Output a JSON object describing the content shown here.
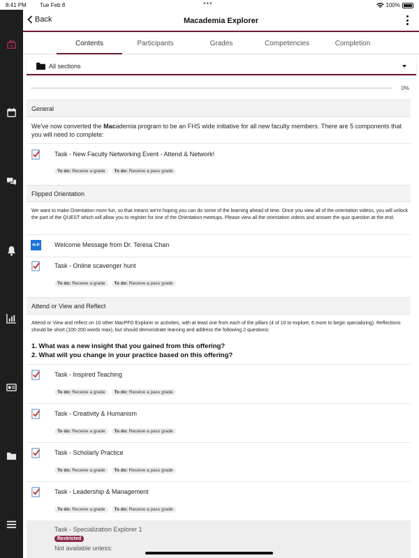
{
  "status": {
    "time": "8:41 PM",
    "date": "Tue Feb 8",
    "battery": "100%"
  },
  "header": {
    "back_label": "Back",
    "title": "Macademia Explorer"
  },
  "tabs": [
    {
      "label": "Contents",
      "active": true
    },
    {
      "label": "Participants",
      "active": false
    },
    {
      "label": "Grades",
      "active": false
    },
    {
      "label": "Competencies",
      "active": false
    },
    {
      "label": "Completion",
      "active": false
    }
  ],
  "section_select": {
    "value": "All sections"
  },
  "progress": {
    "percent": 0,
    "label": "0%"
  },
  "sections": {
    "general": {
      "title": "General",
      "description_pre": "We've now converted the ",
      "description_bold": "Mac",
      "description_post": "ademia program to be an FHS wide initiative for all new faculty members. There are 5 components that you will need to complete:",
      "items": [
        {
          "name": "Task - New Faculty Networking Event - Attend & Network!",
          "todo1": "Receive a grade",
          "todo2": "Receive a pass grade"
        }
      ]
    },
    "flipped": {
      "title": "Flipped Orientation",
      "description": "We want to make Orientation more fun, so that means we're hoping you can do some of the learning ahead of time. Once you view all of the orientation videos, you will unlock the part of the QUEST which will allow you to register for one of the Orientation meetups. Please view all the orientation videos and answer the quiz question at the end.",
      "items": [
        {
          "name": "Welcome Message from Dr. Teresa Chan"
        },
        {
          "name": "Task - Online scavenger hunt",
          "todo1": "Receive a grade",
          "todo2": "Receive a pass grade"
        }
      ]
    },
    "attend": {
      "title": "Attend or View and Reflect",
      "description": "Attend or View and reflect on 10 other MacPFD Explorer or activities, with at least one from each of the pillars (4 of 10 to explore, 6 more to begin specializing). Reflections should be short (100-200 words max), but should demonstrate learning and address the following 2 questions:",
      "q1": "1. What was a new insight that you gained from this offering?",
      "q2": "2. What will you change in your practice based on this offering?",
      "items": [
        {
          "name": "Task - Inspired Teaching",
          "todo1": "Receive a grade",
          "todo2": "Receive a pass grade"
        },
        {
          "name": "Task - Creativity & Humanism",
          "todo1": "Receive a grade",
          "todo2": "Receive a pass grade"
        },
        {
          "name": "Task - Scholarly Practice",
          "todo1": "Receive a grade",
          "todo2": "Receive a pass grade"
        },
        {
          "name": "Task - Leadership & Management",
          "todo1": "Receive a grade",
          "todo2": "Receive a pass grade"
        }
      ],
      "restricted": {
        "name": "Task - Specialization Explorer 1",
        "tag": "Restricted",
        "note": "Not available unless:"
      }
    }
  },
  "todo_prefix": "To do:",
  "hp_badge": "H-P",
  "colors": {
    "accent": "#6b1a2e",
    "rail": "#1e1e1e",
    "restricted": "#8e2a4e"
  },
  "rail_icons": [
    "course-icon",
    "calendar-icon",
    "messages-icon",
    "notifications-icon",
    "grades-icon",
    "participants-card-icon",
    "files-icon",
    "menu-icon"
  ]
}
